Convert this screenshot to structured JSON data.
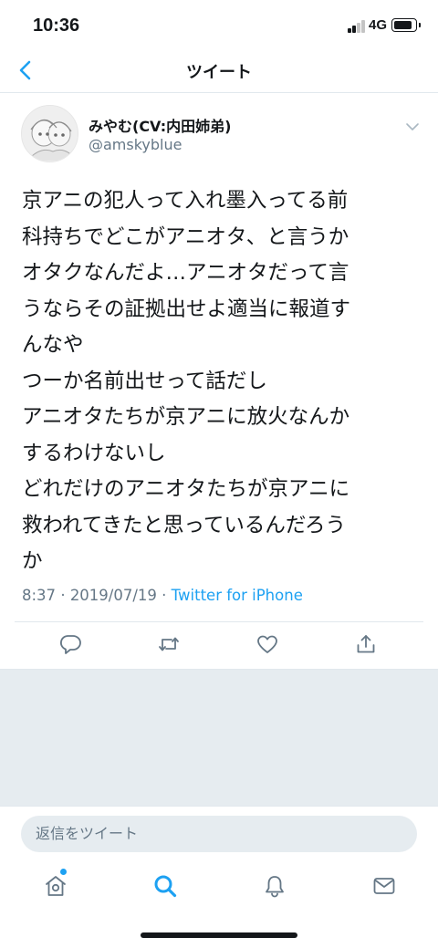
{
  "status_bar": {
    "time": "10:36",
    "network": "4G"
  },
  "header": {
    "title": "ツイート"
  },
  "tweet": {
    "display_name": "みやむ(CV:内田姉弟)",
    "handle": "@amskyblue",
    "text_lines": [
      "京アニの犯人って入れ墨入ってる前",
      "科持ちでどこがアニオタ、と言うか",
      "オタクなんだよ…アニオタだって言",
      "うならその証拠出せよ適当に報道す",
      "んなや",
      "つーか名前出せって話だし",
      "アニオタたちが京アニに放火なんか",
      "するわけないし",
      "どれだけのアニオタたちが京アニに",
      "救われてきたと思っているんだろう",
      "か"
    ],
    "time": "8:37",
    "date": "2019/07/19",
    "separator": "·",
    "source": "Twitter for iPhone"
  },
  "reply": {
    "placeholder": "返信をツイート"
  },
  "icons": {
    "back": "chevron-left-icon",
    "caret": "chevron-down-icon",
    "reply": "reply-icon",
    "retweet": "retweet-icon",
    "like": "heart-icon",
    "share": "share-icon",
    "home": "home-icon",
    "search": "search-icon",
    "notifications": "bell-icon",
    "messages": "mail-icon"
  },
  "colors": {
    "accent": "#1da1f2",
    "secondary_text": "#657786",
    "primary_text": "#14171a",
    "background_grey": "#e6ecf0"
  }
}
